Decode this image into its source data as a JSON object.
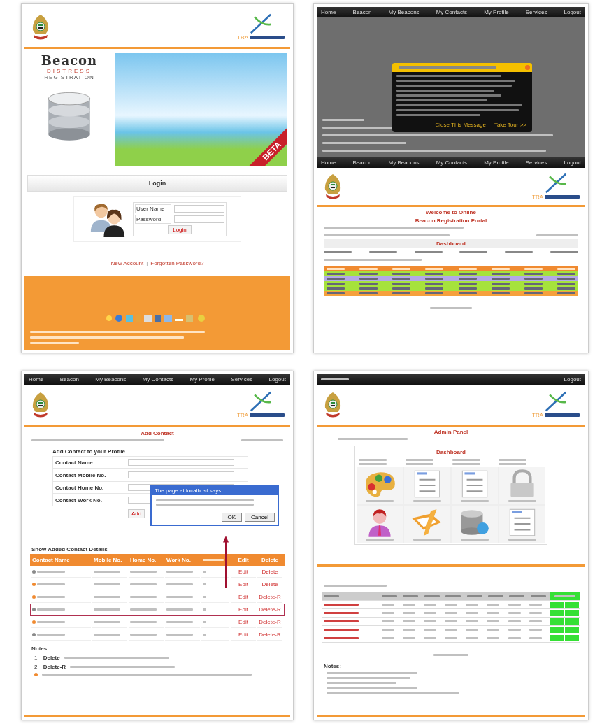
{
  "login_page": {
    "logo_text": "TRA",
    "brand": {
      "title": "Beacon",
      "line_1": "DISTRESS",
      "line_2": "REGISTRATION"
    },
    "ribbon": "BETA",
    "heading": "Login",
    "fields": [
      {
        "label": "User Name"
      },
      {
        "label": "Password"
      }
    ],
    "button": "Login",
    "links": [
      "New Account",
      "Forgotten Password?"
    ],
    "separator": "|"
  },
  "dashboard_page": {
    "nav": [
      "Home",
      "Beacon",
      "My Beacons",
      "My Contacts",
      "My Profile",
      "Services",
      "Logout"
    ],
    "popup": {
      "buttons": [
        "Close This Message",
        "Take Tour >>"
      ]
    },
    "nav_2": [
      "Home",
      "Beacon",
      "My Beacons",
      "My Contacts",
      "My Profile",
      "Services",
      "Logout"
    ],
    "logo_text": "TRA",
    "welcome": "Welcome to Online",
    "portal": "Beacon Registration Portal",
    "dashboard_title": "Dashboard",
    "rows": [
      {
        "color": "#a6e23c"
      },
      {
        "color": "#b4a8e8"
      },
      {
        "color": "#a6e23c"
      },
      {
        "color": "#a6e23c"
      },
      {
        "color": "#f5a03c"
      }
    ]
  },
  "contact_page": {
    "nav": [
      "Home",
      "Beacon",
      "My Beacons",
      "My Contacts",
      "My Profile",
      "Services",
      "Logout"
    ],
    "logo_text": "TRA",
    "title": "Add Contact",
    "form_title": "Add Contact to your Profile",
    "fields": [
      {
        "label": "Contact Name"
      },
      {
        "label": "Contact Mobile No."
      },
      {
        "label": "Contact Home No."
      },
      {
        "label": "Contact Work No."
      }
    ],
    "add_button": "Add",
    "dialog": {
      "title": "The page at localhost says:",
      "buttons": [
        "OK",
        "Cancel"
      ]
    },
    "table_title": "Show Added Contact Details",
    "columns": [
      "Contact Name",
      "Mobile No.",
      "Home No.",
      "Work No.",
      "Edit",
      "Delete"
    ],
    "rows": [
      {
        "color": "#8a8a8a",
        "selected": false,
        "edit": "Edit",
        "delete": "Delete"
      },
      {
        "color": "#f08a30",
        "selected": false,
        "edit": "Edit",
        "delete": "Delete"
      },
      {
        "color": "#f08a30",
        "selected": false,
        "edit": "Edit",
        "delete": "Delete-R"
      },
      {
        "color": "#8a8a8a",
        "selected": true,
        "edit": "Edit",
        "delete": "Delete-R"
      },
      {
        "color": "#f08a30",
        "selected": false,
        "edit": "Edit",
        "delete": "Delete-R"
      },
      {
        "color": "#8a8a8a",
        "selected": false,
        "edit": "Edit",
        "delete": "Delete-R"
      }
    ],
    "notes_title": "Notes:",
    "notes": [
      {
        "number": "1.",
        "term": "Delete"
      },
      {
        "number": "2.",
        "term": "Delete-R"
      }
    ]
  },
  "admin_page": {
    "nav": [
      "Logout"
    ],
    "logo_text": "TRA",
    "title": "Admin Panel",
    "dashboard_title": "Dashboard",
    "notes_title": "Notes:"
  }
}
